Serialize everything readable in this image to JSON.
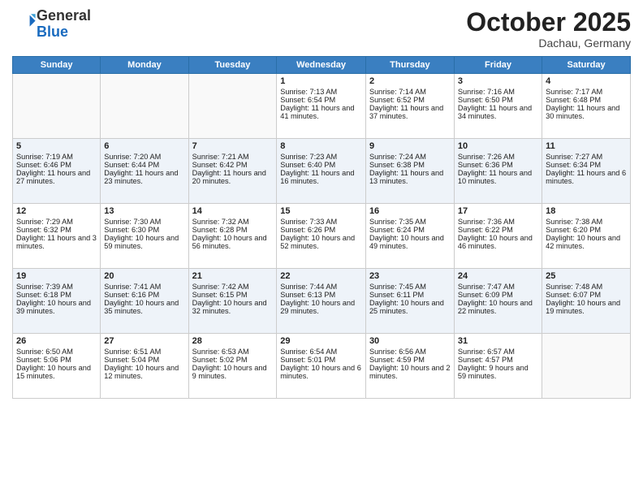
{
  "header": {
    "logo_general": "General",
    "logo_blue": "Blue",
    "month": "October 2025",
    "location": "Dachau, Germany"
  },
  "weekdays": [
    "Sunday",
    "Monday",
    "Tuesday",
    "Wednesday",
    "Thursday",
    "Friday",
    "Saturday"
  ],
  "weeks": [
    [
      {
        "day": "",
        "info": ""
      },
      {
        "day": "",
        "info": ""
      },
      {
        "day": "",
        "info": ""
      },
      {
        "day": "1",
        "info": "Sunrise: 7:13 AM\nSunset: 6:54 PM\nDaylight: 11 hours and 41 minutes."
      },
      {
        "day": "2",
        "info": "Sunrise: 7:14 AM\nSunset: 6:52 PM\nDaylight: 11 hours and 37 minutes."
      },
      {
        "day": "3",
        "info": "Sunrise: 7:16 AM\nSunset: 6:50 PM\nDaylight: 11 hours and 34 minutes."
      },
      {
        "day": "4",
        "info": "Sunrise: 7:17 AM\nSunset: 6:48 PM\nDaylight: 11 hours and 30 minutes."
      }
    ],
    [
      {
        "day": "5",
        "info": "Sunrise: 7:19 AM\nSunset: 6:46 PM\nDaylight: 11 hours and 27 minutes."
      },
      {
        "day": "6",
        "info": "Sunrise: 7:20 AM\nSunset: 6:44 PM\nDaylight: 11 hours and 23 minutes."
      },
      {
        "day": "7",
        "info": "Sunrise: 7:21 AM\nSunset: 6:42 PM\nDaylight: 11 hours and 20 minutes."
      },
      {
        "day": "8",
        "info": "Sunrise: 7:23 AM\nSunset: 6:40 PM\nDaylight: 11 hours and 16 minutes."
      },
      {
        "day": "9",
        "info": "Sunrise: 7:24 AM\nSunset: 6:38 PM\nDaylight: 11 hours and 13 minutes."
      },
      {
        "day": "10",
        "info": "Sunrise: 7:26 AM\nSunset: 6:36 PM\nDaylight: 11 hours and 10 minutes."
      },
      {
        "day": "11",
        "info": "Sunrise: 7:27 AM\nSunset: 6:34 PM\nDaylight: 11 hours and 6 minutes."
      }
    ],
    [
      {
        "day": "12",
        "info": "Sunrise: 7:29 AM\nSunset: 6:32 PM\nDaylight: 11 hours and 3 minutes."
      },
      {
        "day": "13",
        "info": "Sunrise: 7:30 AM\nSunset: 6:30 PM\nDaylight: 10 hours and 59 minutes."
      },
      {
        "day": "14",
        "info": "Sunrise: 7:32 AM\nSunset: 6:28 PM\nDaylight: 10 hours and 56 minutes."
      },
      {
        "day": "15",
        "info": "Sunrise: 7:33 AM\nSunset: 6:26 PM\nDaylight: 10 hours and 52 minutes."
      },
      {
        "day": "16",
        "info": "Sunrise: 7:35 AM\nSunset: 6:24 PM\nDaylight: 10 hours and 49 minutes."
      },
      {
        "day": "17",
        "info": "Sunrise: 7:36 AM\nSunset: 6:22 PM\nDaylight: 10 hours and 46 minutes."
      },
      {
        "day": "18",
        "info": "Sunrise: 7:38 AM\nSunset: 6:20 PM\nDaylight: 10 hours and 42 minutes."
      }
    ],
    [
      {
        "day": "19",
        "info": "Sunrise: 7:39 AM\nSunset: 6:18 PM\nDaylight: 10 hours and 39 minutes."
      },
      {
        "day": "20",
        "info": "Sunrise: 7:41 AM\nSunset: 6:16 PM\nDaylight: 10 hours and 35 minutes."
      },
      {
        "day": "21",
        "info": "Sunrise: 7:42 AM\nSunset: 6:15 PM\nDaylight: 10 hours and 32 minutes."
      },
      {
        "day": "22",
        "info": "Sunrise: 7:44 AM\nSunset: 6:13 PM\nDaylight: 10 hours and 29 minutes."
      },
      {
        "day": "23",
        "info": "Sunrise: 7:45 AM\nSunset: 6:11 PM\nDaylight: 10 hours and 25 minutes."
      },
      {
        "day": "24",
        "info": "Sunrise: 7:47 AM\nSunset: 6:09 PM\nDaylight: 10 hours and 22 minutes."
      },
      {
        "day": "25",
        "info": "Sunrise: 7:48 AM\nSunset: 6:07 PM\nDaylight: 10 hours and 19 minutes."
      }
    ],
    [
      {
        "day": "26",
        "info": "Sunrise: 6:50 AM\nSunset: 5:06 PM\nDaylight: 10 hours and 15 minutes."
      },
      {
        "day": "27",
        "info": "Sunrise: 6:51 AM\nSunset: 5:04 PM\nDaylight: 10 hours and 12 minutes."
      },
      {
        "day": "28",
        "info": "Sunrise: 6:53 AM\nSunset: 5:02 PM\nDaylight: 10 hours and 9 minutes."
      },
      {
        "day": "29",
        "info": "Sunrise: 6:54 AM\nSunset: 5:01 PM\nDaylight: 10 hours and 6 minutes."
      },
      {
        "day": "30",
        "info": "Sunrise: 6:56 AM\nSunset: 4:59 PM\nDaylight: 10 hours and 2 minutes."
      },
      {
        "day": "31",
        "info": "Sunrise: 6:57 AM\nSunset: 4:57 PM\nDaylight: 9 hours and 59 minutes."
      },
      {
        "day": "",
        "info": ""
      }
    ]
  ]
}
